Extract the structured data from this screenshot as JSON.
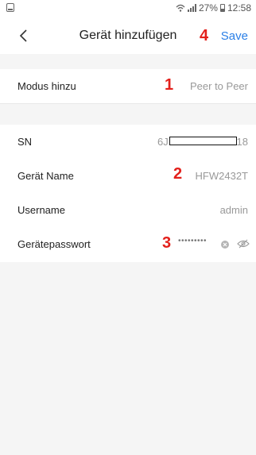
{
  "status_bar": {
    "battery": "27%",
    "time": "12:58"
  },
  "header": {
    "title": "Gerät hinzufügen",
    "save_label": "Save"
  },
  "annotations": [
    "1",
    "2",
    "3",
    "4"
  ],
  "rows": {
    "mode": {
      "label": "Modus hinzu",
      "value": "Peer to Peer"
    },
    "sn": {
      "label": "SN",
      "value_prefix": "6J",
      "value_suffix": "18"
    },
    "name": {
      "label": "Gerät Name",
      "value": "HFW2432T"
    },
    "username": {
      "label": "Username",
      "value": "admin"
    },
    "password": {
      "label": "Gerätepasswort",
      "value": "•••••••••"
    }
  },
  "icons": {
    "back": "chevron-left-icon",
    "clear": "clear-circle-icon",
    "visibility": "eye-hidden-icon"
  },
  "colors": {
    "accent": "#2a7fe6",
    "annotation": "#e3201b"
  }
}
